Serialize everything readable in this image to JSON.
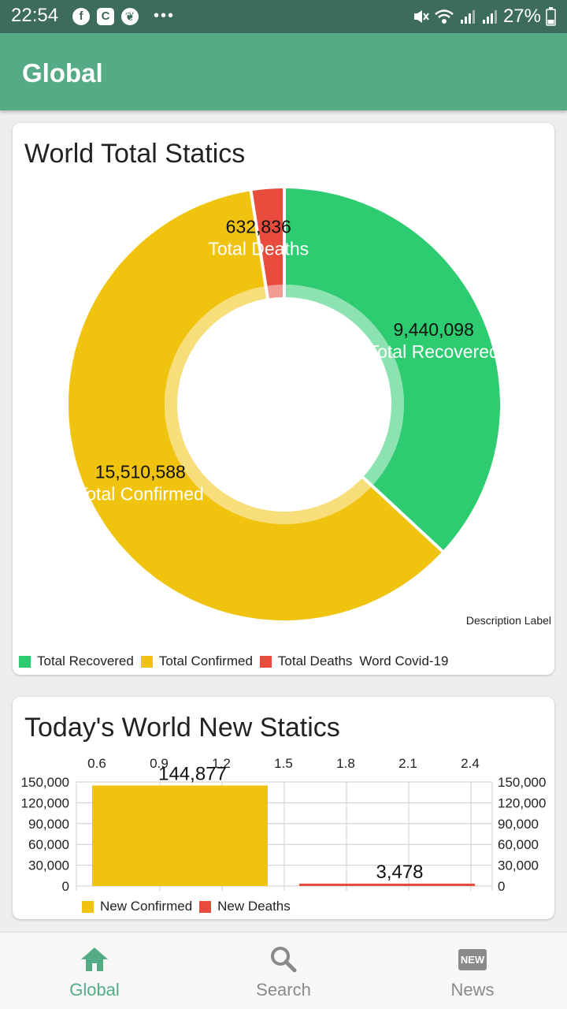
{
  "status_bar": {
    "time": "22:54",
    "battery": "27%",
    "left_icons": [
      "facebook-icon",
      "c-app-icon",
      "leaf-app-icon",
      "more-dots-icon"
    ],
    "right_icons": [
      "mute-icon",
      "wifi-icon",
      "signal-icon",
      "signal-icon",
      "battery-icon"
    ]
  },
  "app_bar": {
    "title": "Global"
  },
  "world_card": {
    "title": "World Total Statics",
    "description_label": "Description Label",
    "legend_label": "Word Covid-19",
    "chart_data": {
      "type": "pie",
      "donut": true,
      "slices": [
        {
          "name": "Total Recovered",
          "value": 9440098,
          "value_label": "9,440,098",
          "color": "#2ecc71"
        },
        {
          "name": "Total Confirmed",
          "value": 15510588,
          "value_label": "15,510,588",
          "color": "#f0c30f"
        },
        {
          "name": "Total Deaths",
          "value": 632836,
          "value_label": "632,836",
          "color": "#e74c3c"
        }
      ]
    }
  },
  "today_card": {
    "title": "Today's World New Statics",
    "chart_data": {
      "type": "bar",
      "top_axis_ticks": [
        "0.6",
        "0.9",
        "1.2",
        "1.5",
        "1.8",
        "2.1",
        "2.4"
      ],
      "y_ticks": [
        "150,000",
        "120,000",
        "90,000",
        "60,000",
        "30,000",
        "0"
      ],
      "ylim": [
        0,
        150000
      ],
      "series": [
        {
          "name": "New Confirmed",
          "value": 144877,
          "value_label": "144,877",
          "color": "#f0c30f"
        },
        {
          "name": "New Deaths",
          "value": 3478,
          "value_label": "3,478",
          "color": "#e74c3c"
        }
      ]
    }
  },
  "bottom_nav": {
    "items": [
      {
        "label": "Global",
        "icon": "home-icon",
        "active": true
      },
      {
        "label": "Search",
        "icon": "search-icon",
        "active": false
      },
      {
        "label": "News",
        "icon": "news-icon",
        "active": false,
        "badge": "NEW"
      }
    ]
  }
}
